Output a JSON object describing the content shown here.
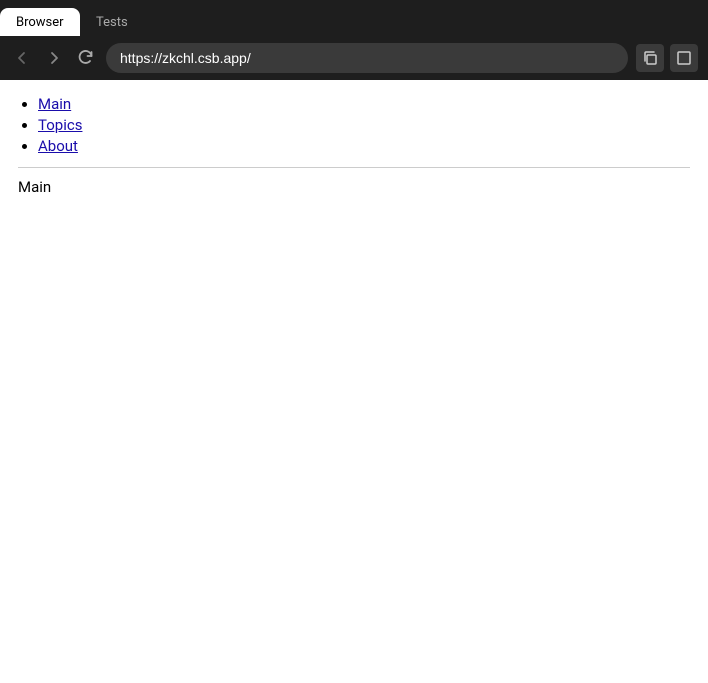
{
  "browser": {
    "tab_active_label": "Browser",
    "tab_inactive_label": "Tests",
    "address": "https://zkchl.csb.app/",
    "copy_icon": "⧉",
    "menu_icon": "□"
  },
  "nav": {
    "items": [
      {
        "label": "Main",
        "href": "#"
      },
      {
        "label": "Topics",
        "href": "#"
      },
      {
        "label": "About",
        "href": "#"
      }
    ]
  },
  "page": {
    "heading": "Main"
  }
}
